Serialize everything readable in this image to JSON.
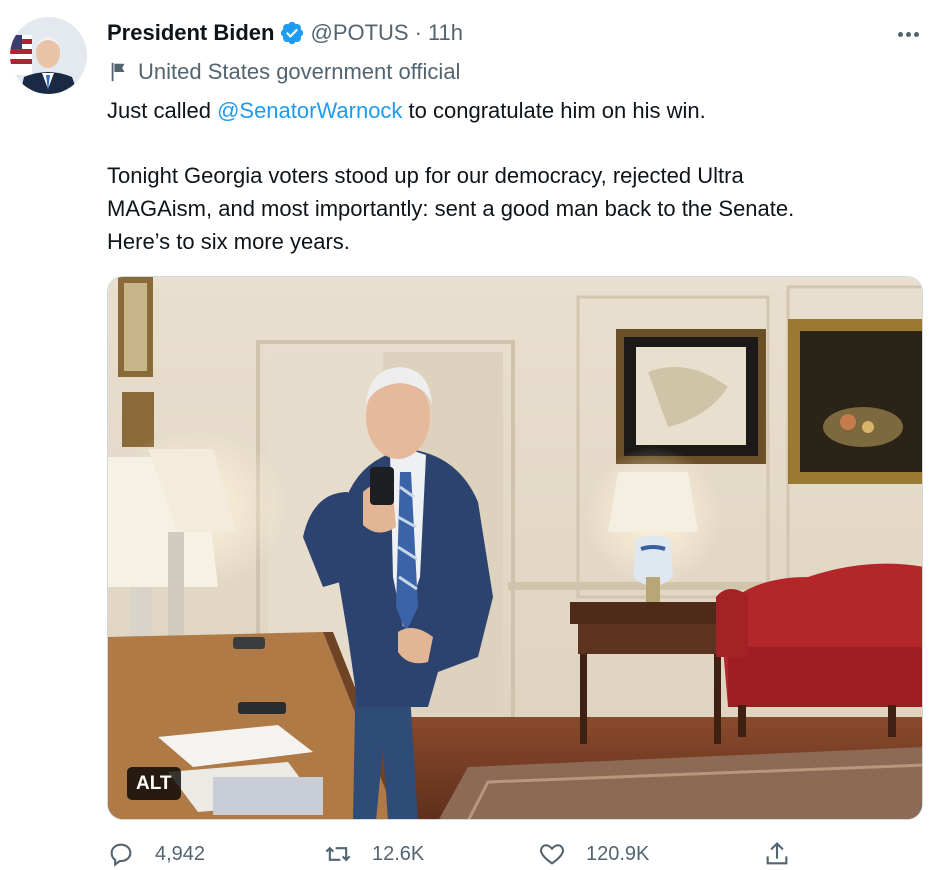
{
  "tweet": {
    "author": {
      "display_name": "President Biden",
      "handle": "@POTUS",
      "separator": "·",
      "time": "11h",
      "label": "United States government official",
      "avatar_icon": "avatar-photo",
      "verified_icon": "verified-badge-icon",
      "verified_color": "#1d9bf0"
    },
    "text": {
      "line1_before": "Just called ",
      "mention": "@SenatorWarnock",
      "line1_after": " to congratulate him on his win.",
      "para2_line1": "Tonight Georgia voters stood up for our democracy, rejected Ultra",
      "para2_line2": "MAGAism, and most importantly: sent a good man back to the Senate.",
      "para2_line3": "Here’s to six more years."
    },
    "media": {
      "alt_badge": "ALT"
    },
    "actions": {
      "replies": "4,942",
      "retweets": "12.6K",
      "likes": "120.9K"
    }
  },
  "colors": {
    "text": "#0f1419",
    "secondary": "#536471",
    "link": "#1d9bf0"
  }
}
